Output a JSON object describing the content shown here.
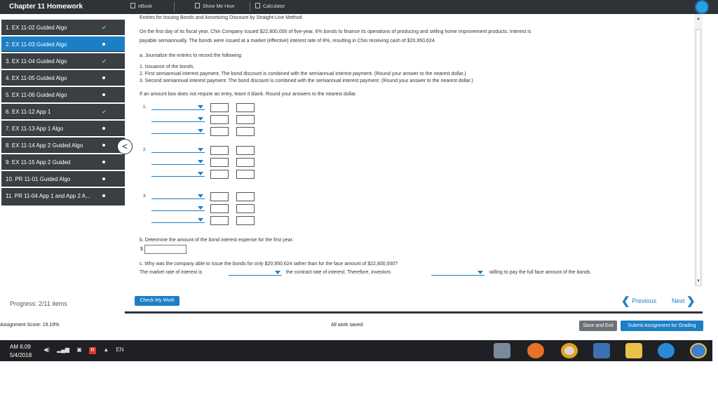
{
  "sidebar": {
    "title": "Chapter 11 Homework",
    "items": [
      {
        "label": "1. EX 11-02 Guided Algo",
        "status": "check",
        "active": false
      },
      {
        "label": "2. EX 11-03 Guided Algo",
        "status": "dot",
        "active": true
      },
      {
        "label": "3. EX 11-04 Guided Algo",
        "status": "check",
        "active": false
      },
      {
        "label": "4. EX 11-05 Guided Algo",
        "status": "dot",
        "active": false
      },
      {
        "label": "5. EX 11-06 Guided Algo",
        "status": "dot",
        "active": false
      },
      {
        "label": "6. EX 11-12 App 1",
        "status": "check",
        "active": false
      },
      {
        "label": "7. EX 11-13 App 1 Algo",
        "status": "dot",
        "active": false
      },
      {
        "label": "8. EX 11-14 App 2 Guided Algo",
        "status": "dot",
        "active": false
      },
      {
        "label": "9. EX 11-15 App 2 Guided",
        "status": "dot",
        "active": false
      },
      {
        "label": "10. PR 11-01 Guided Algo",
        "status": "dot",
        "active": false
      },
      {
        "label": "11. PR 11-04 App 1 and App 2 A...",
        "status": "dot",
        "active": false
      }
    ],
    "progress": "Progress: 2/11 items",
    "collapse_glyph": "<"
  },
  "toolbar": {
    "ebook": "eBook",
    "show_me_how": "Show Me How",
    "calculator": "Calculator"
  },
  "question": {
    "heading": "Entries for Issuing Bonds and Amortizing Discount by Straight-Line Method",
    "para1_line1": "On the first day of its fiscal year, Chin Company issued $22,800,000 of five-year, 6% bonds to finance its operations of producing and selling home improvement products. Interest is",
    "para1_line2": "payable semiannually. The bonds were issued at a market (effective) interest rate of 8%, resulting in Chin receiving cash of $20,950,624.",
    "part_a": "a. Journalize the entries to record the following:",
    "a1": "1. Issuance of the bonds.",
    "a2": "2. First semiannual interest payment. The bond discount is combined with the semiannual interest payment. (Round your answer to the nearest dollar.)",
    "a3": "3. Second semiannual interest payment. The bond discount is combined with the semiannual interest payment. (Round your answer to the nearest dollar.)",
    "hint": "If an amount box does not require an entry, leave it blank. Round your answers to the nearest dollar.",
    "entry_numbers": [
      "1.",
      "2.",
      "3."
    ],
    "part_b": "b. Determine the amount of the bond interest expense for the first year.",
    "dollar": "$",
    "part_c": "c. Why was the company able to issue the bonds for only $20,950,624 rather than for the face amount of $22,800,000?",
    "c_sentence_1": "The market rate of interest is",
    "c_sentence_2": "the contract rate of interest. Therefore, investors",
    "c_sentence_3": "willing to pay the full face amount of the bonds."
  },
  "actions": {
    "check_my_work": "Check My Work",
    "previous": "Previous",
    "next": "Next"
  },
  "status": {
    "assignment_score": "Assignment Score: 19.19%",
    "saved": "All work saved.",
    "save_and_exit": "Save and Exit",
    "submit": "Submit Assignment for Grading"
  },
  "taskbar": {
    "time": "AM 6:09",
    "date": "5/4/2018",
    "lang": "EN"
  },
  "colors": {
    "accent": "#1c7fc5",
    "dark": "#2f3338",
    "sidebar_item": "#3a3f44",
    "check": "#8ad04a"
  }
}
